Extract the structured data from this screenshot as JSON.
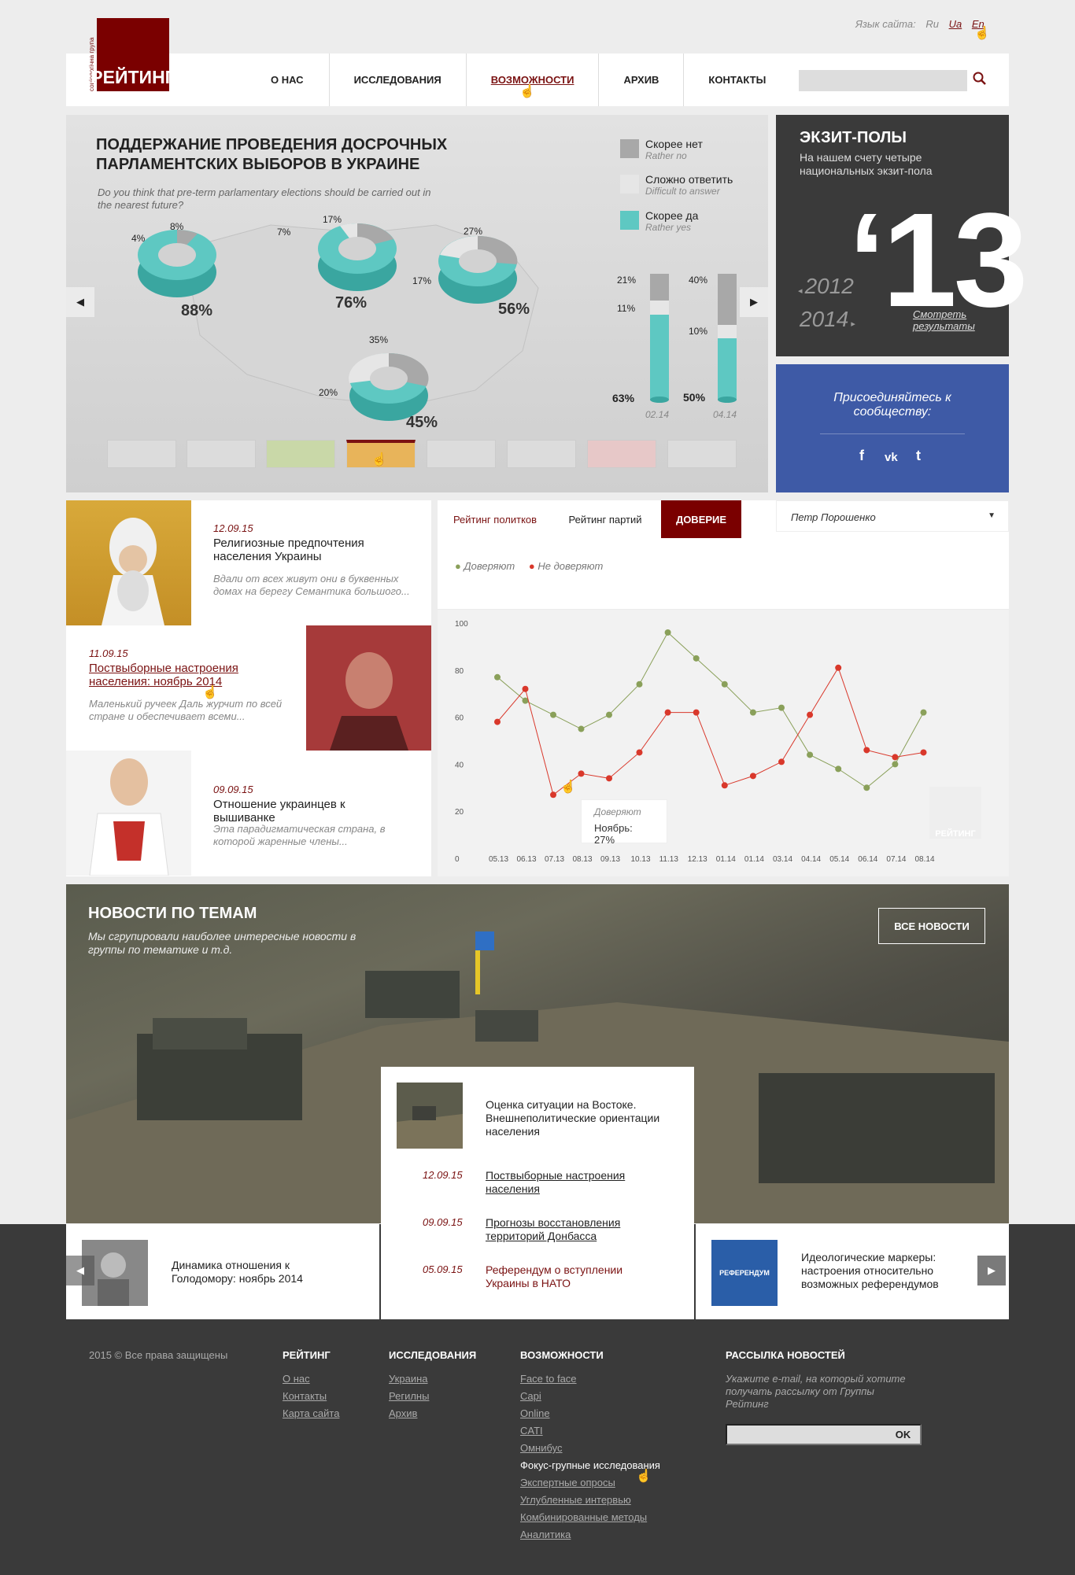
{
  "lang": {
    "label": "Язык сайта:",
    "ru": "Ru",
    "ua": "Ua",
    "en": "En"
  },
  "logo": {
    "vertical": "соціологічна група",
    "name": "РЕЙТИНГ"
  },
  "nav": [
    "О НАС",
    "ИССЛЕДОВАНИЯ",
    "ВОЗМОЖНОСТИ",
    "АРХИВ",
    "КОНТАКТЫ"
  ],
  "slider": {
    "title": "ПОДДЕРЖАНИЕ ПРОВЕДЕНИЯ ДОСРОЧНЫХ ПАРЛАМЕНТСКИХ ВЫБОРОВ В УКРАИНЕ",
    "subtitle": "Do you think that pre-term parlamentary elections should be carried out in the nearest future?",
    "legend": [
      {
        "ru": "Скорее нет",
        "en": "Rather no",
        "color": "#a8a8a8"
      },
      {
        "ru": "Сложно ответить",
        "en": "Difficult to answer",
        "color": "#e6e6e6"
      },
      {
        "ru": "Скорее да",
        "en": "Rather yes",
        "color": "#5ec8c2"
      }
    ],
    "donuts": [
      {
        "no": "4%",
        "diff": "8%",
        "yes": "88%"
      },
      {
        "no": "7%",
        "diff": "17%",
        "yes": "76%"
      },
      {
        "no": "17%",
        "diff": "27%",
        "yes": "56%"
      },
      {
        "no": "20%",
        "diff": "35%",
        "yes": "45%"
      }
    ],
    "bars": [
      {
        "date": "02.14",
        "no": "21%",
        "diff": "11%",
        "yes": "63%"
      },
      {
        "date": "04.14",
        "no": "40%",
        "diff": "10%",
        "yes": "50%"
      }
    ]
  },
  "exit": {
    "title": "ЭКЗИТ-ПОЛЫ",
    "sub": "На нашем счету четыре национальных экзит-пола",
    "big": "‘13",
    "y1": "2012",
    "y2": "2014",
    "more": "Смотреть результаты"
  },
  "social": {
    "text": "Присоединяйтесь к сообществу:",
    "fb": "f",
    "vk": "vk",
    "tw": "t"
  },
  "news": [
    {
      "date": "12.09.15",
      "title": "Религиозные предпочтения населения Украины",
      "excerpt": "Вдали от всех живут они в буквенных домах на берегу Семантика большого..."
    },
    {
      "date": "11.09.15",
      "title": "Поствыборные настроения населения: ноябрь 2014",
      "excerpt": "Маленький ручеек Даль журчит по всей стране и обеспечивает всеми..."
    },
    {
      "date": "09.09.15",
      "title": "Отношение украинцев к вышиванке",
      "excerpt": "Эта парадигматическая страна, в которой жаренные члены..."
    }
  ],
  "chart_panel": {
    "tabs": [
      "Рейтинг политков",
      "Рейтинг партий",
      "ДОВЕРИЕ"
    ],
    "dropdown": "Петр Порошенко",
    "legend": [
      "Доверяют",
      "Не доверяют"
    ],
    "tooltip": {
      "label": "Доверяют",
      "value": "Ноябрь: 27%"
    },
    "watermark": "РЕЙТИНГ"
  },
  "chart_data": {
    "type": "line",
    "x": [
      "05.13",
      "06.13",
      "07.13",
      "08.13",
      "09.13",
      "10.13",
      "11.13",
      "12.13",
      "01.14",
      "01.14",
      "03.14",
      "04.14",
      "05.14",
      "06.14",
      "07.14",
      "08.14"
    ],
    "series": [
      {
        "name": "Доверяют",
        "color": "#8aa05a",
        "values": [
          77,
          67,
          61,
          55,
          61,
          74,
          96,
          85,
          74,
          62,
          64,
          44,
          38,
          30,
          40,
          62
        ]
      },
      {
        "name": "Не доверяют",
        "color": "#d9382b",
        "values": [
          58,
          72,
          27,
          36,
          34,
          45,
          62,
          62,
          31,
          35,
          41,
          61,
          81,
          46,
          43,
          45
        ]
      }
    ],
    "yticks": [
      0,
      20,
      40,
      60,
      80,
      100
    ],
    "ylim": [
      0,
      100
    ]
  },
  "themes": {
    "title": "НОВОСТИ ПО ТЕМАМ",
    "sub": "Мы сгрупировали наиболее интересные новости в группы по тематике и т.д.",
    "all": "ВСЕ НОВОСТИ",
    "featured": "Оценка ситуации на Востоке. Внешнеполитические ориентации населения",
    "links": [
      {
        "date": "12.09.15",
        "text": "Поствыборные настроения населения"
      },
      {
        "date": "09.09.15",
        "text": "Прогнозы восстановления территорий Донбасса"
      },
      {
        "date": "05.09.15",
        "text": "Референдум о вступлении Украины в НАТО"
      }
    ],
    "left_card": "Динамика отношения к Голодомору: ноябрь 2014",
    "right_card": "Идеологические маркеры: настроения относительно возможных референдумов",
    "right_img_label": "РЕФЕРЕНДУМ"
  },
  "footer": {
    "copy": "2015 © Все права защищены",
    "col1": {
      "title": "РЕЙТИНГ",
      "items": [
        "О нас",
        "Контакты",
        "Карта сайта"
      ]
    },
    "col2": {
      "title": "ИССЛЕДОВАНИЯ",
      "items": [
        "Украина",
        "Регилны",
        "Архив"
      ]
    },
    "col3": {
      "title": "ВОЗМОЖНОСТИ",
      "items": [
        "Face to face",
        "Capi",
        "Online",
        "CATI",
        "Омнибус",
        "Фокус-групные исследования",
        "Экспертные опросы",
        "Углубленные интервью",
        "Комбинированные методы",
        "Аналитика"
      ]
    },
    "col4": {
      "title": "РАССЫЛКА НОВОСТЕЙ",
      "text": "Укажите e-mail, на который хотите получать рассылку от Группы Рейтинг",
      "ok": "OK"
    }
  }
}
